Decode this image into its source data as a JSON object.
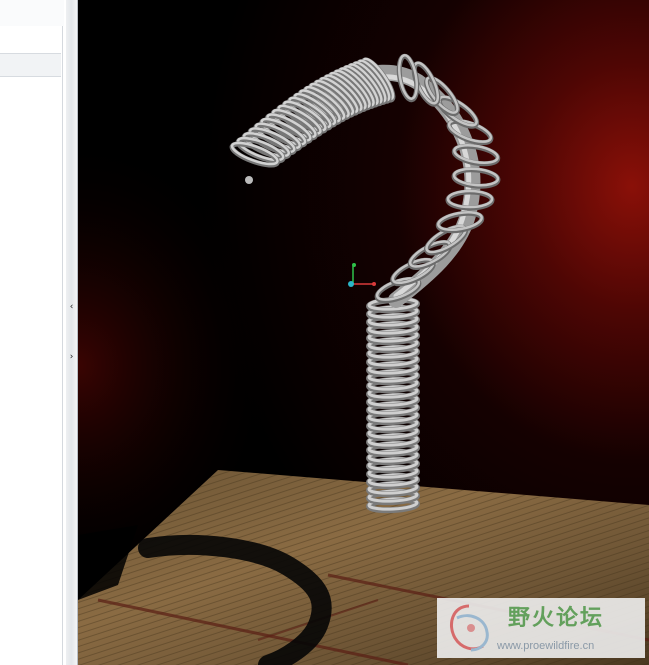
{
  "app": {
    "left_panel": {
      "collapse_icon": "chevron-left-icon",
      "expand_icon": "chevron-right-icon"
    },
    "viewport": {
      "scene_objects": [
        "coil-spring-model",
        "textured-floor-plane",
        "spring-shadow"
      ],
      "axis_colors": {
        "x": "#d93a3a",
        "y": "#2fc24a",
        "z": "#2ab6c8"
      },
      "background_glow_color": "#8a1008"
    },
    "watermark": {
      "title": "野火论坛",
      "url": "www.proewildfire.cn",
      "logo_icon": "swirl-logo-icon"
    }
  }
}
